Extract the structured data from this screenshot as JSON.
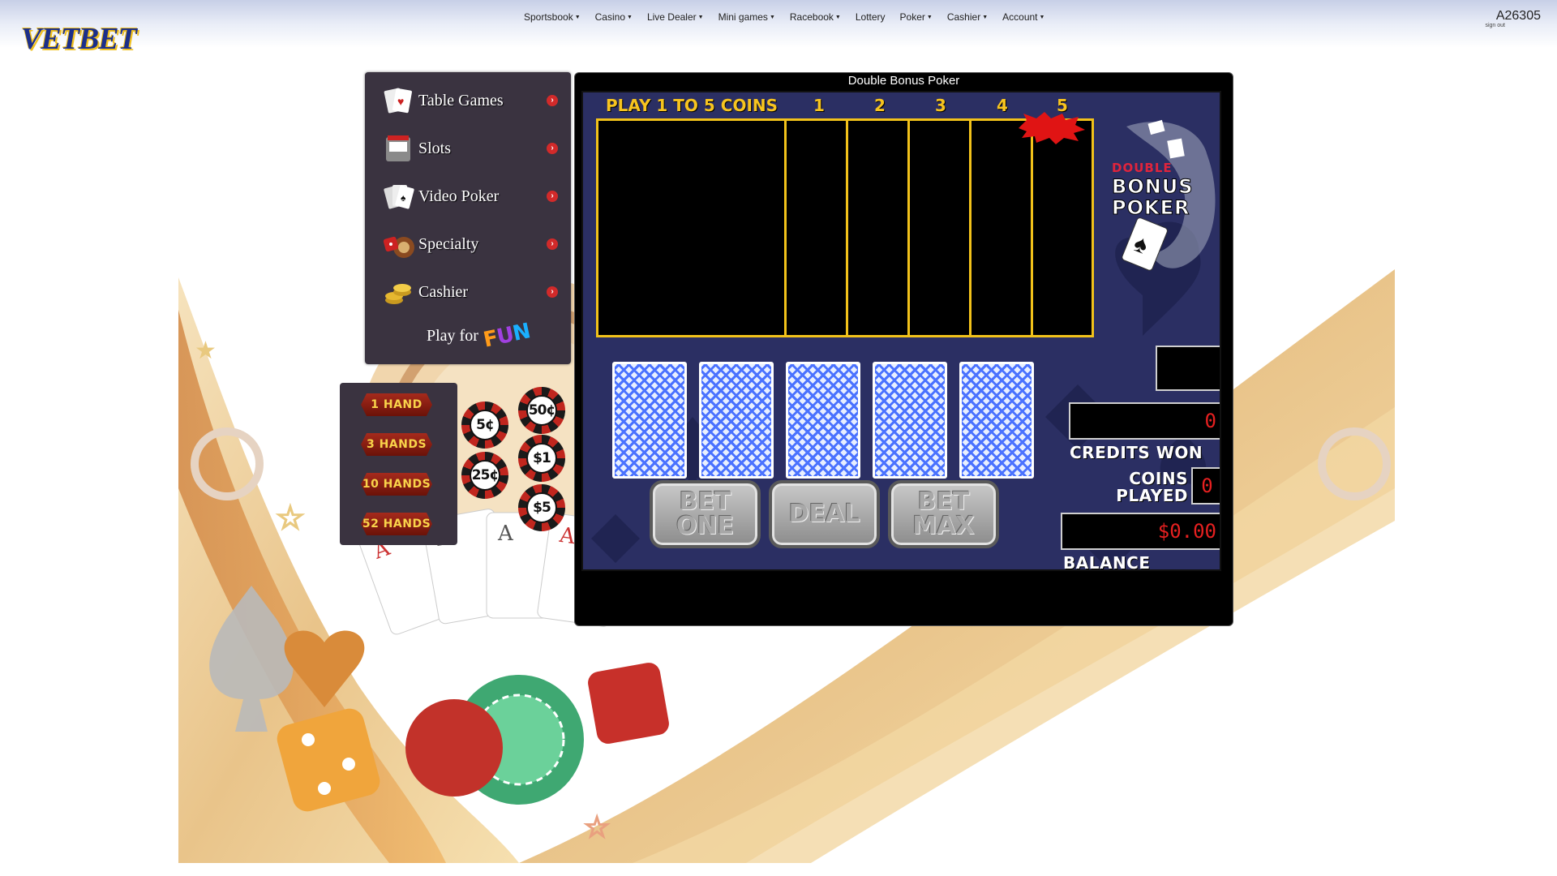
{
  "header": {
    "brand": "VETBET",
    "nav": [
      {
        "label": "Sportsbook",
        "dropdown": true
      },
      {
        "label": "Casino",
        "dropdown": true
      },
      {
        "label": "Live Dealer",
        "dropdown": true
      },
      {
        "label": "Mini games",
        "dropdown": true
      },
      {
        "label": "Racebook",
        "dropdown": true
      },
      {
        "label": "Lottery",
        "dropdown": false
      },
      {
        "label": "Poker",
        "dropdown": true
      },
      {
        "label": "Cashier",
        "dropdown": true
      },
      {
        "label": "Account",
        "dropdown": true
      }
    ],
    "account_id": "A26305",
    "sign_out": "sign out"
  },
  "menu": {
    "items": [
      {
        "label": "Table Games",
        "icon": "playing-cards-icon"
      },
      {
        "label": "Slots",
        "icon": "slot-machine-icon"
      },
      {
        "label": "Video Poker",
        "icon": "poker-hand-icon"
      },
      {
        "label": "Specialty",
        "icon": "roulette-dice-icon"
      },
      {
        "label": "Cashier",
        "icon": "gold-coins-icon"
      }
    ],
    "play_for": "Play for",
    "fun": "FUN"
  },
  "hands": [
    "1 HAND",
    "3 HANDS",
    "10 HANDS",
    "52 HANDS"
  ],
  "chips": [
    "5¢",
    "50¢",
    "25¢",
    "$1",
    "$5"
  ],
  "game": {
    "title": "Double Bonus Poker",
    "coins_header": "PLAY 1 TO 5 COINS",
    "coin_columns": [
      "1",
      "2",
      "3",
      "4",
      "5"
    ],
    "logo_line1": "DOUBLE",
    "logo_line2": "BONUS",
    "logo_line3": "POKER",
    "buttons": {
      "bet_one_1": "BET",
      "bet_one_2": "ONE",
      "deal": "DEAL",
      "bet_max_1": "BET",
      "bet_max_2": "MAX"
    },
    "credits_won_value": "0",
    "credits_won_label": "CREDITS WON",
    "coins_played_label_1": "COINS",
    "coins_played_label_2": "PLAYED",
    "coins_played_value": "0",
    "balance_value": "$0.00",
    "balance_label": "BALANCE"
  },
  "colors": {
    "accent_gold": "#f2c21a",
    "felt": "#2b2f63",
    "digits": "#e62020"
  }
}
